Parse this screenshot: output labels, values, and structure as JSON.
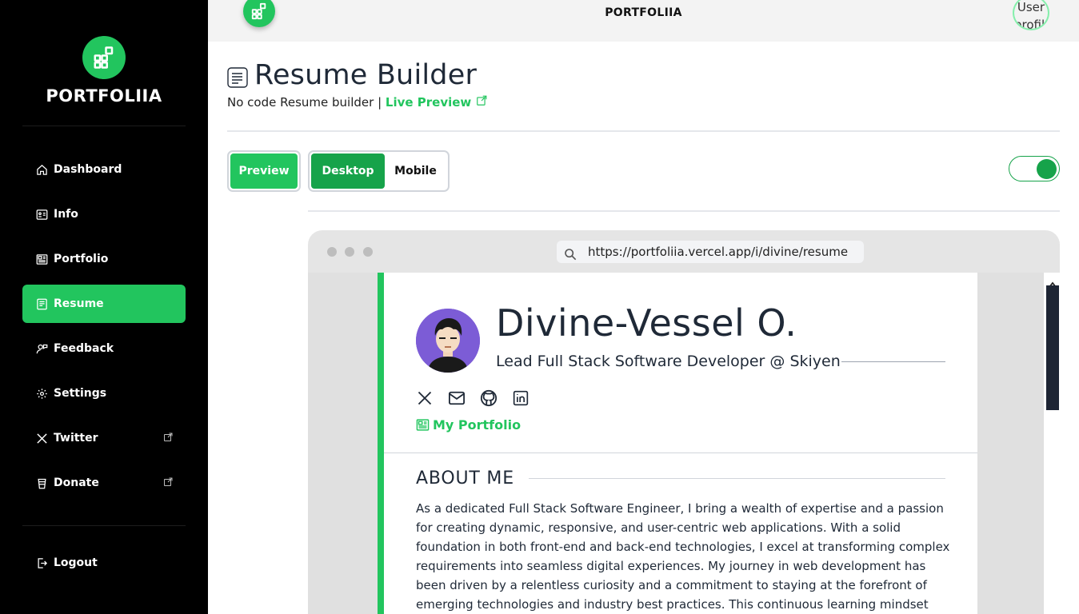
{
  "app": {
    "brand": "PORTFOLIIA",
    "top_title": "PORTFOLIIA",
    "profile_alt": "User profile"
  },
  "sidebar": {
    "items": [
      {
        "label": "Dashboard",
        "icon": "home-icon"
      },
      {
        "label": "Info",
        "icon": "id-card-icon"
      },
      {
        "label": "Portfolio",
        "icon": "newspaper-icon"
      },
      {
        "label": "Resume",
        "icon": "document-icon",
        "active": true
      },
      {
        "label": "Feedback",
        "icon": "user-feedback-icon"
      },
      {
        "label": "Settings",
        "icon": "gear-icon"
      },
      {
        "label": "Twitter",
        "icon": "x-logo-icon",
        "external": true
      },
      {
        "label": "Donate",
        "icon": "coffee-cup-icon",
        "external": true
      }
    ],
    "logout": "Logout"
  },
  "page": {
    "title": "Resume Builder",
    "subtitle_prefix": "No code Resume builder | ",
    "live_preview": "Live Preview"
  },
  "controls": {
    "preview_label": "Preview",
    "desktop_label": "Desktop",
    "mobile_label": "Mobile",
    "toggle_on": true
  },
  "browser": {
    "url": "https://portfoliia.vercel.app/i/divine/resume"
  },
  "resume": {
    "name": "Divine-Vessel O.",
    "role": "Lead Full Stack Software Developer @ Skiyen",
    "portfolio_link": "My Portfolio",
    "about_heading": "ABOUT ME",
    "about_text": "As a dedicated Full Stack Software Engineer, I bring a wealth of expertise and a passion for creating dynamic, responsive, and user-centric web applications. With a solid foundation in both front-end and back-end technologies, I excel at transforming complex requirements into seamless digital experiences. My journey in web development has been driven by a relentless curiosity and a commitment to staying at the forefront of emerging technologies and industry best practices. This continuous learning mindset"
  },
  "colors": {
    "accent": "#22c55e",
    "accent_dark": "#16a34a",
    "sidebar_bg": "#000000"
  }
}
